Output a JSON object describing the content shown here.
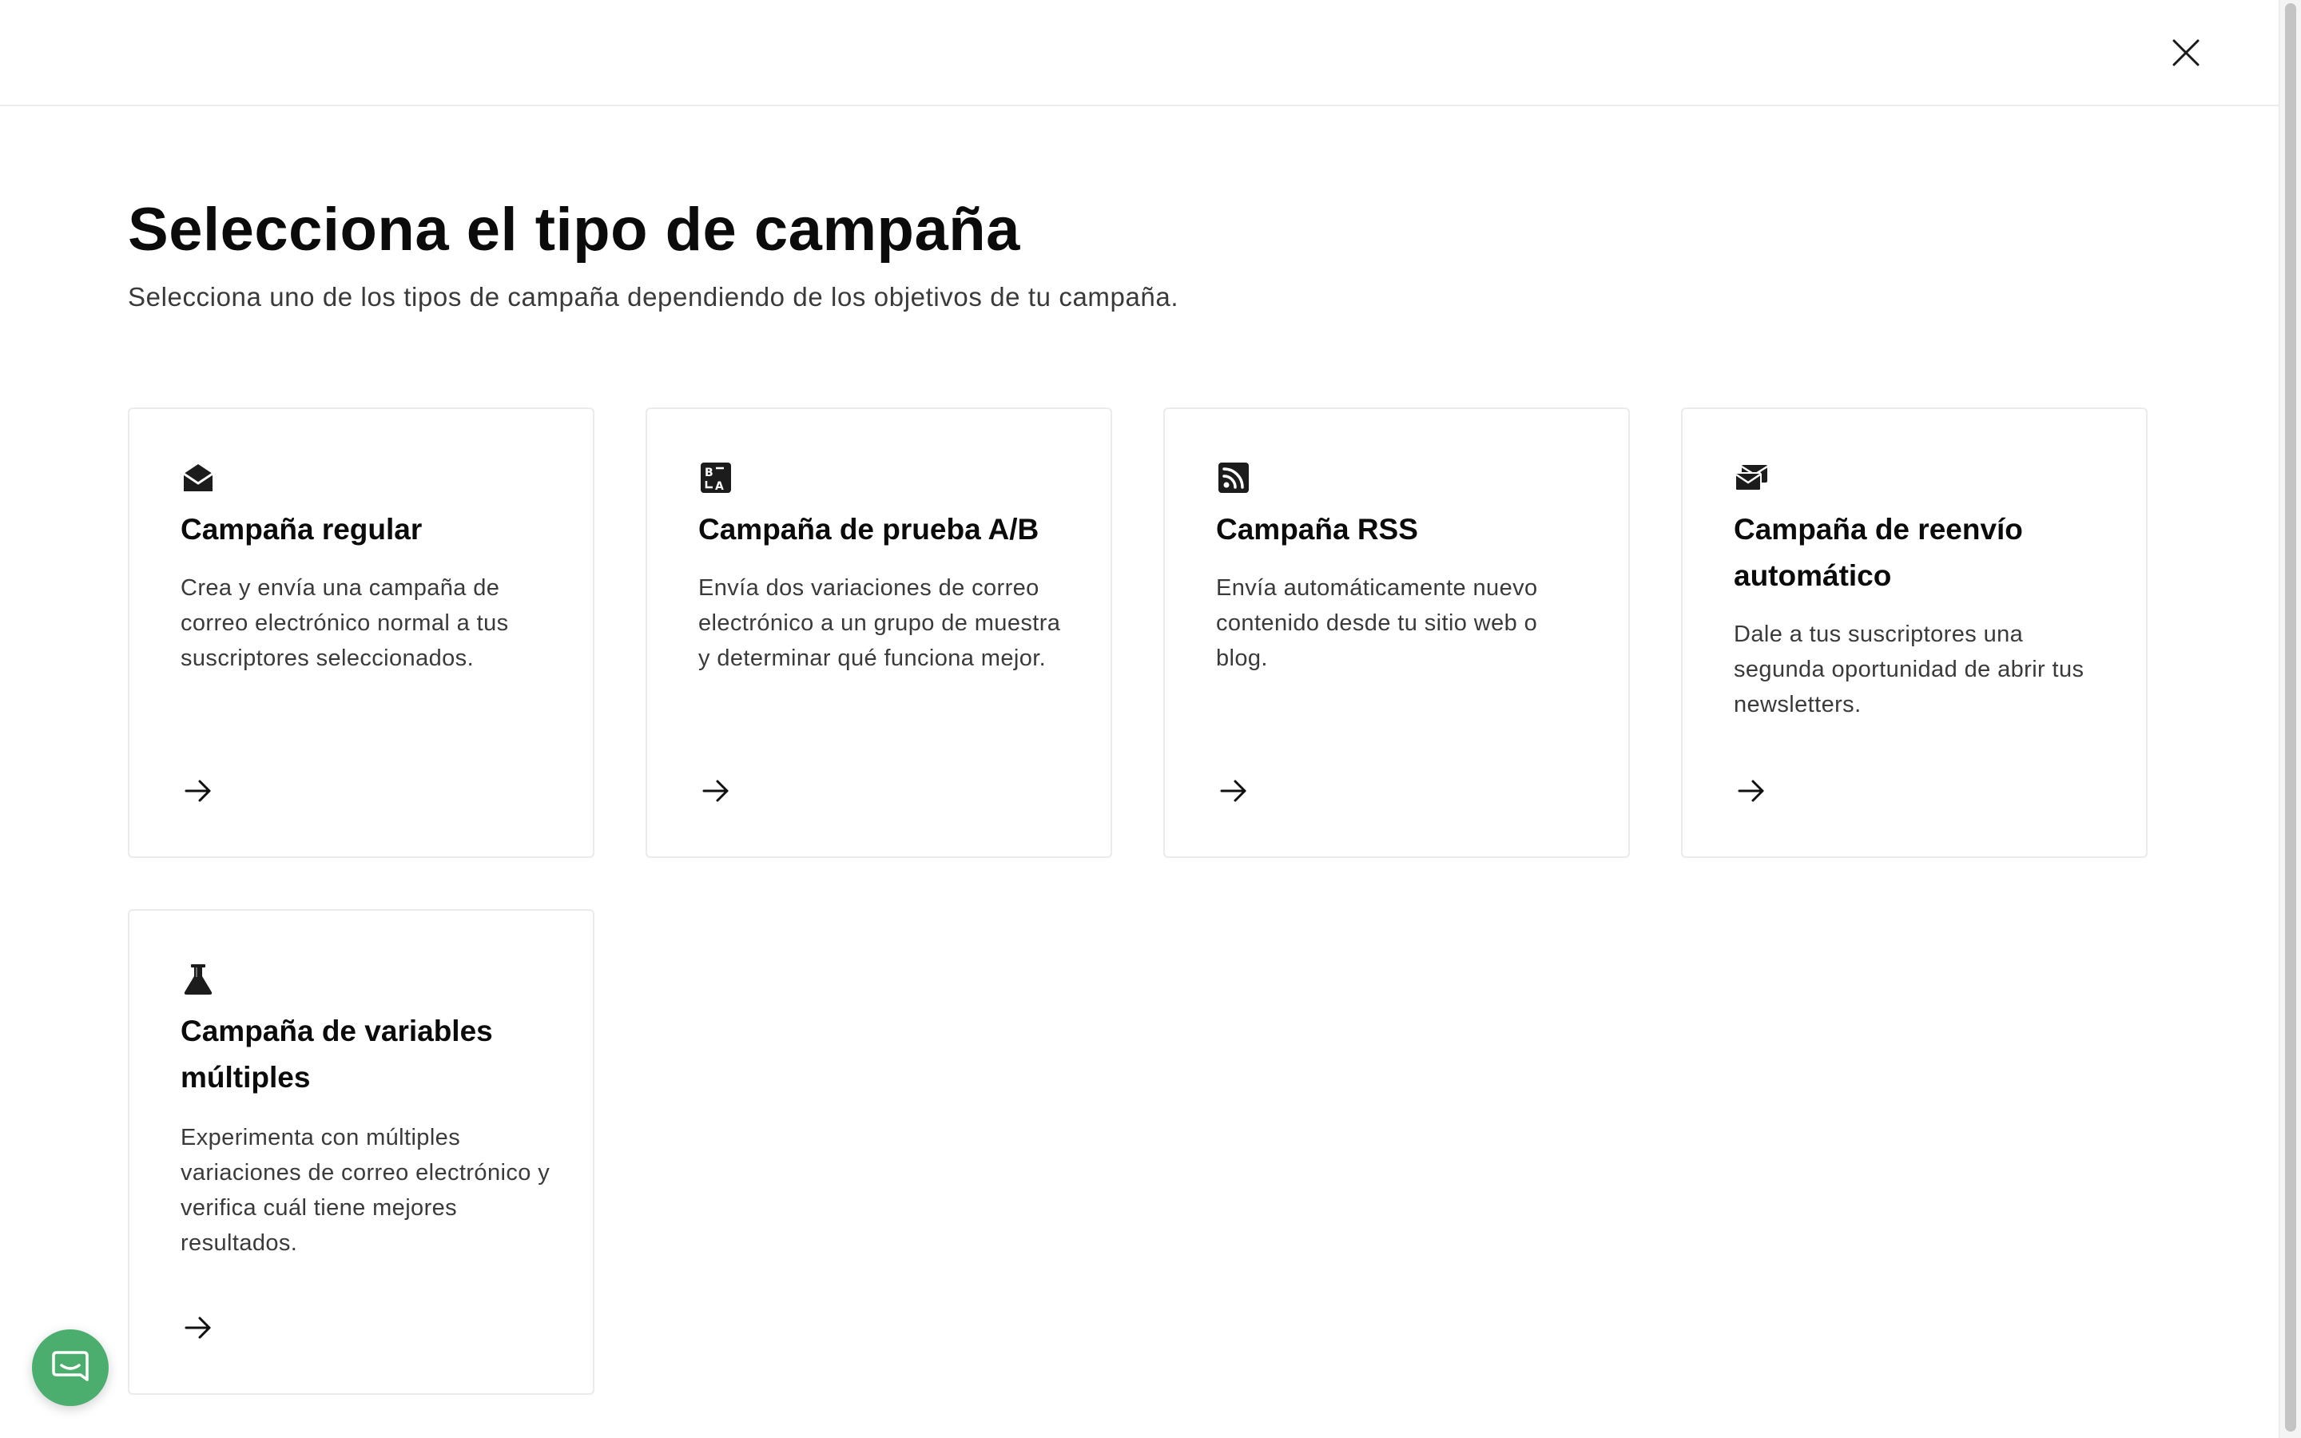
{
  "header": {
    "close_label": "×"
  },
  "main": {
    "title": "Selecciona el tipo de campaña",
    "subtitle": "Selecciona uno de los tipos de campaña dependiendo de los objetivos de tu campaña."
  },
  "cards": [
    {
      "icon": "envelope-open-icon",
      "title": "Campaña regular",
      "description": "Crea y envía una campaña de correo electrónico normal a tus suscriptores seleccionados."
    },
    {
      "icon": "translate-ab-icon",
      "title": "Campaña de prueba A/B",
      "description": "Envía dos variaciones de correo electrónico a un grupo de muestra y determinar qué funciona mejor."
    },
    {
      "icon": "rss-icon",
      "title": "Campaña RSS",
      "description": "Envía automáticamente nuevo contenido desde tu sitio web o blog."
    },
    {
      "icon": "resend-envelopes-icon",
      "title": "Campaña de reenvío automático",
      "description": "Dale a tus suscriptores una segunda oportunidad de abrir tus newsletters."
    },
    {
      "icon": "flask-icon",
      "title": "Campaña de variables múltiples",
      "description": "Experimenta con múltiples variaciones de correo electrónico y verifica cuál tiene mejores resultados."
    }
  ],
  "colors": {
    "text": "#0b0b0b",
    "muted_text": "#3a3a3a",
    "border": "#ebebeb",
    "chat_launcher": "#4cae6e"
  },
  "chat": {
    "icon": "chat-bubble-icon"
  }
}
